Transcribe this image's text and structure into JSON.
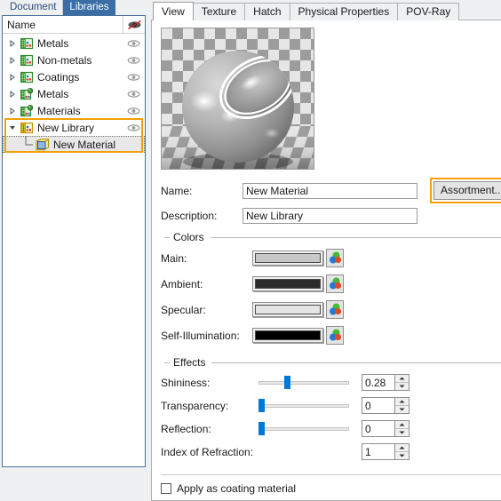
{
  "left_panel": {
    "tabs": [
      {
        "label": "Document",
        "active": false
      },
      {
        "label": "Libraries",
        "active": true
      }
    ],
    "tree_header": {
      "name_label": "Name",
      "visibility_icon": "eye-crossed-icon"
    },
    "tree_items": [
      {
        "label": "Metals",
        "icon": "library-folder-icon",
        "expander": "collapsed",
        "eye": true,
        "indent": 0,
        "selected": false
      },
      {
        "label": "Non-metals",
        "icon": "library-folder-icon",
        "expander": "collapsed",
        "eye": true,
        "indent": 0,
        "selected": false
      },
      {
        "label": "Coatings",
        "icon": "library-folder-icon",
        "expander": "collapsed",
        "eye": true,
        "indent": 0,
        "selected": false
      },
      {
        "label": "Metals",
        "icon": "material-folder-icon",
        "expander": "collapsed",
        "eye": true,
        "indent": 0,
        "selected": false
      },
      {
        "label": "Materials",
        "icon": "material-folder-icon",
        "expander": "collapsed",
        "eye": true,
        "indent": 0,
        "selected": false
      },
      {
        "label": "New Library",
        "icon": "new-library-icon",
        "expander": "expanded",
        "eye": true,
        "indent": 0,
        "selected": false
      },
      {
        "label": "New Material",
        "icon": "material-item-icon",
        "expander": "none",
        "eye": false,
        "indent": 1,
        "selected": true
      }
    ],
    "highlight_color": "#f2a007"
  },
  "right_panel": {
    "tabs": [
      {
        "label": "View",
        "active": true
      },
      {
        "label": "Texture",
        "active": false
      },
      {
        "label": "Hatch",
        "active": false
      },
      {
        "label": "Physical Properties",
        "active": false
      },
      {
        "label": "POV-Ray",
        "active": false
      }
    ],
    "preview": {
      "alt": "material-preview-sphere"
    },
    "name_field": {
      "label": "Name:",
      "value": "New Material",
      "placeholder": ""
    },
    "description_field": {
      "label": "Description:",
      "value": "New Library",
      "placeholder": ""
    },
    "assortment_button": {
      "label": "Assortment...",
      "highlighted": true
    },
    "colors_group": {
      "legend": "Colors",
      "rows": [
        {
          "label": "Main:",
          "color": "#c8c8c8",
          "picker_icon": "color-picker-icon"
        },
        {
          "label": "Ambient:",
          "color": "#2b2b2b",
          "picker_icon": "color-picker-icon"
        },
        {
          "label": "Specular:",
          "color": "#e4e4e4",
          "picker_icon": "color-picker-icon"
        },
        {
          "label": "Self-Illumination:",
          "color": "#000000",
          "picker_icon": "color-picker-icon"
        }
      ]
    },
    "effects_group": {
      "legend": "Effects",
      "rows": [
        {
          "label": "Shininess:",
          "value": "0.28",
          "slider": true,
          "percent": 28
        },
        {
          "label": "Transparency:",
          "value": "0",
          "slider": true,
          "percent": 0
        },
        {
          "label": "Reflection:",
          "value": "0",
          "slider": true,
          "percent": 0
        },
        {
          "label": "Index of Refraction:",
          "value": "1",
          "slider": false,
          "percent": 0
        }
      ],
      "slider_color": "#0078d7"
    },
    "coating_checkbox": {
      "label": "Apply as coating material",
      "checked": false
    }
  }
}
